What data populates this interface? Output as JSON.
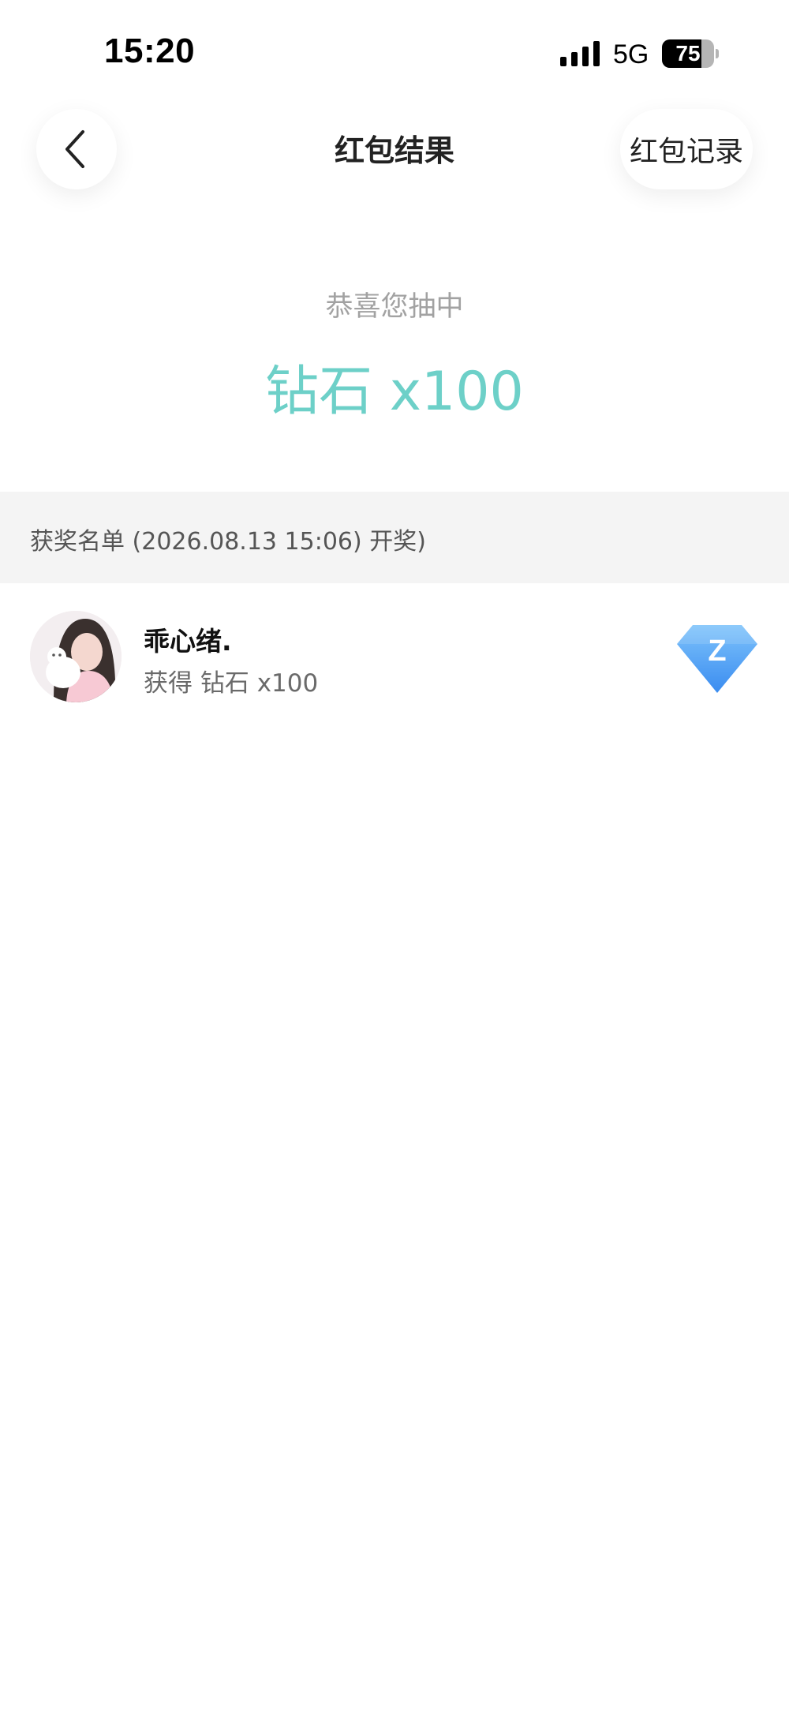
{
  "status_bar": {
    "time": "15:20",
    "network": "5G",
    "battery_level": 75,
    "battery_text": "75",
    "icons": [
      "signal-bars-icon",
      "battery-icon"
    ]
  },
  "nav": {
    "back_icon": "chevron-left-icon",
    "title": "红包结果",
    "records_label": "红包记录"
  },
  "result": {
    "subtitle": "恭喜您抽中",
    "prize": "钻石 x100",
    "prize_color": "#6dd0c8"
  },
  "winners": {
    "header": "获奖名单 (2026.08.13 15:06) 开奖)",
    "items": [
      {
        "name": "乖心绪.",
        "detail": "获得 钻石 x100",
        "badge_icon": "diamond-z-icon",
        "badge_letter": "Z",
        "badge_color": "#4a9ff5"
      }
    ]
  }
}
